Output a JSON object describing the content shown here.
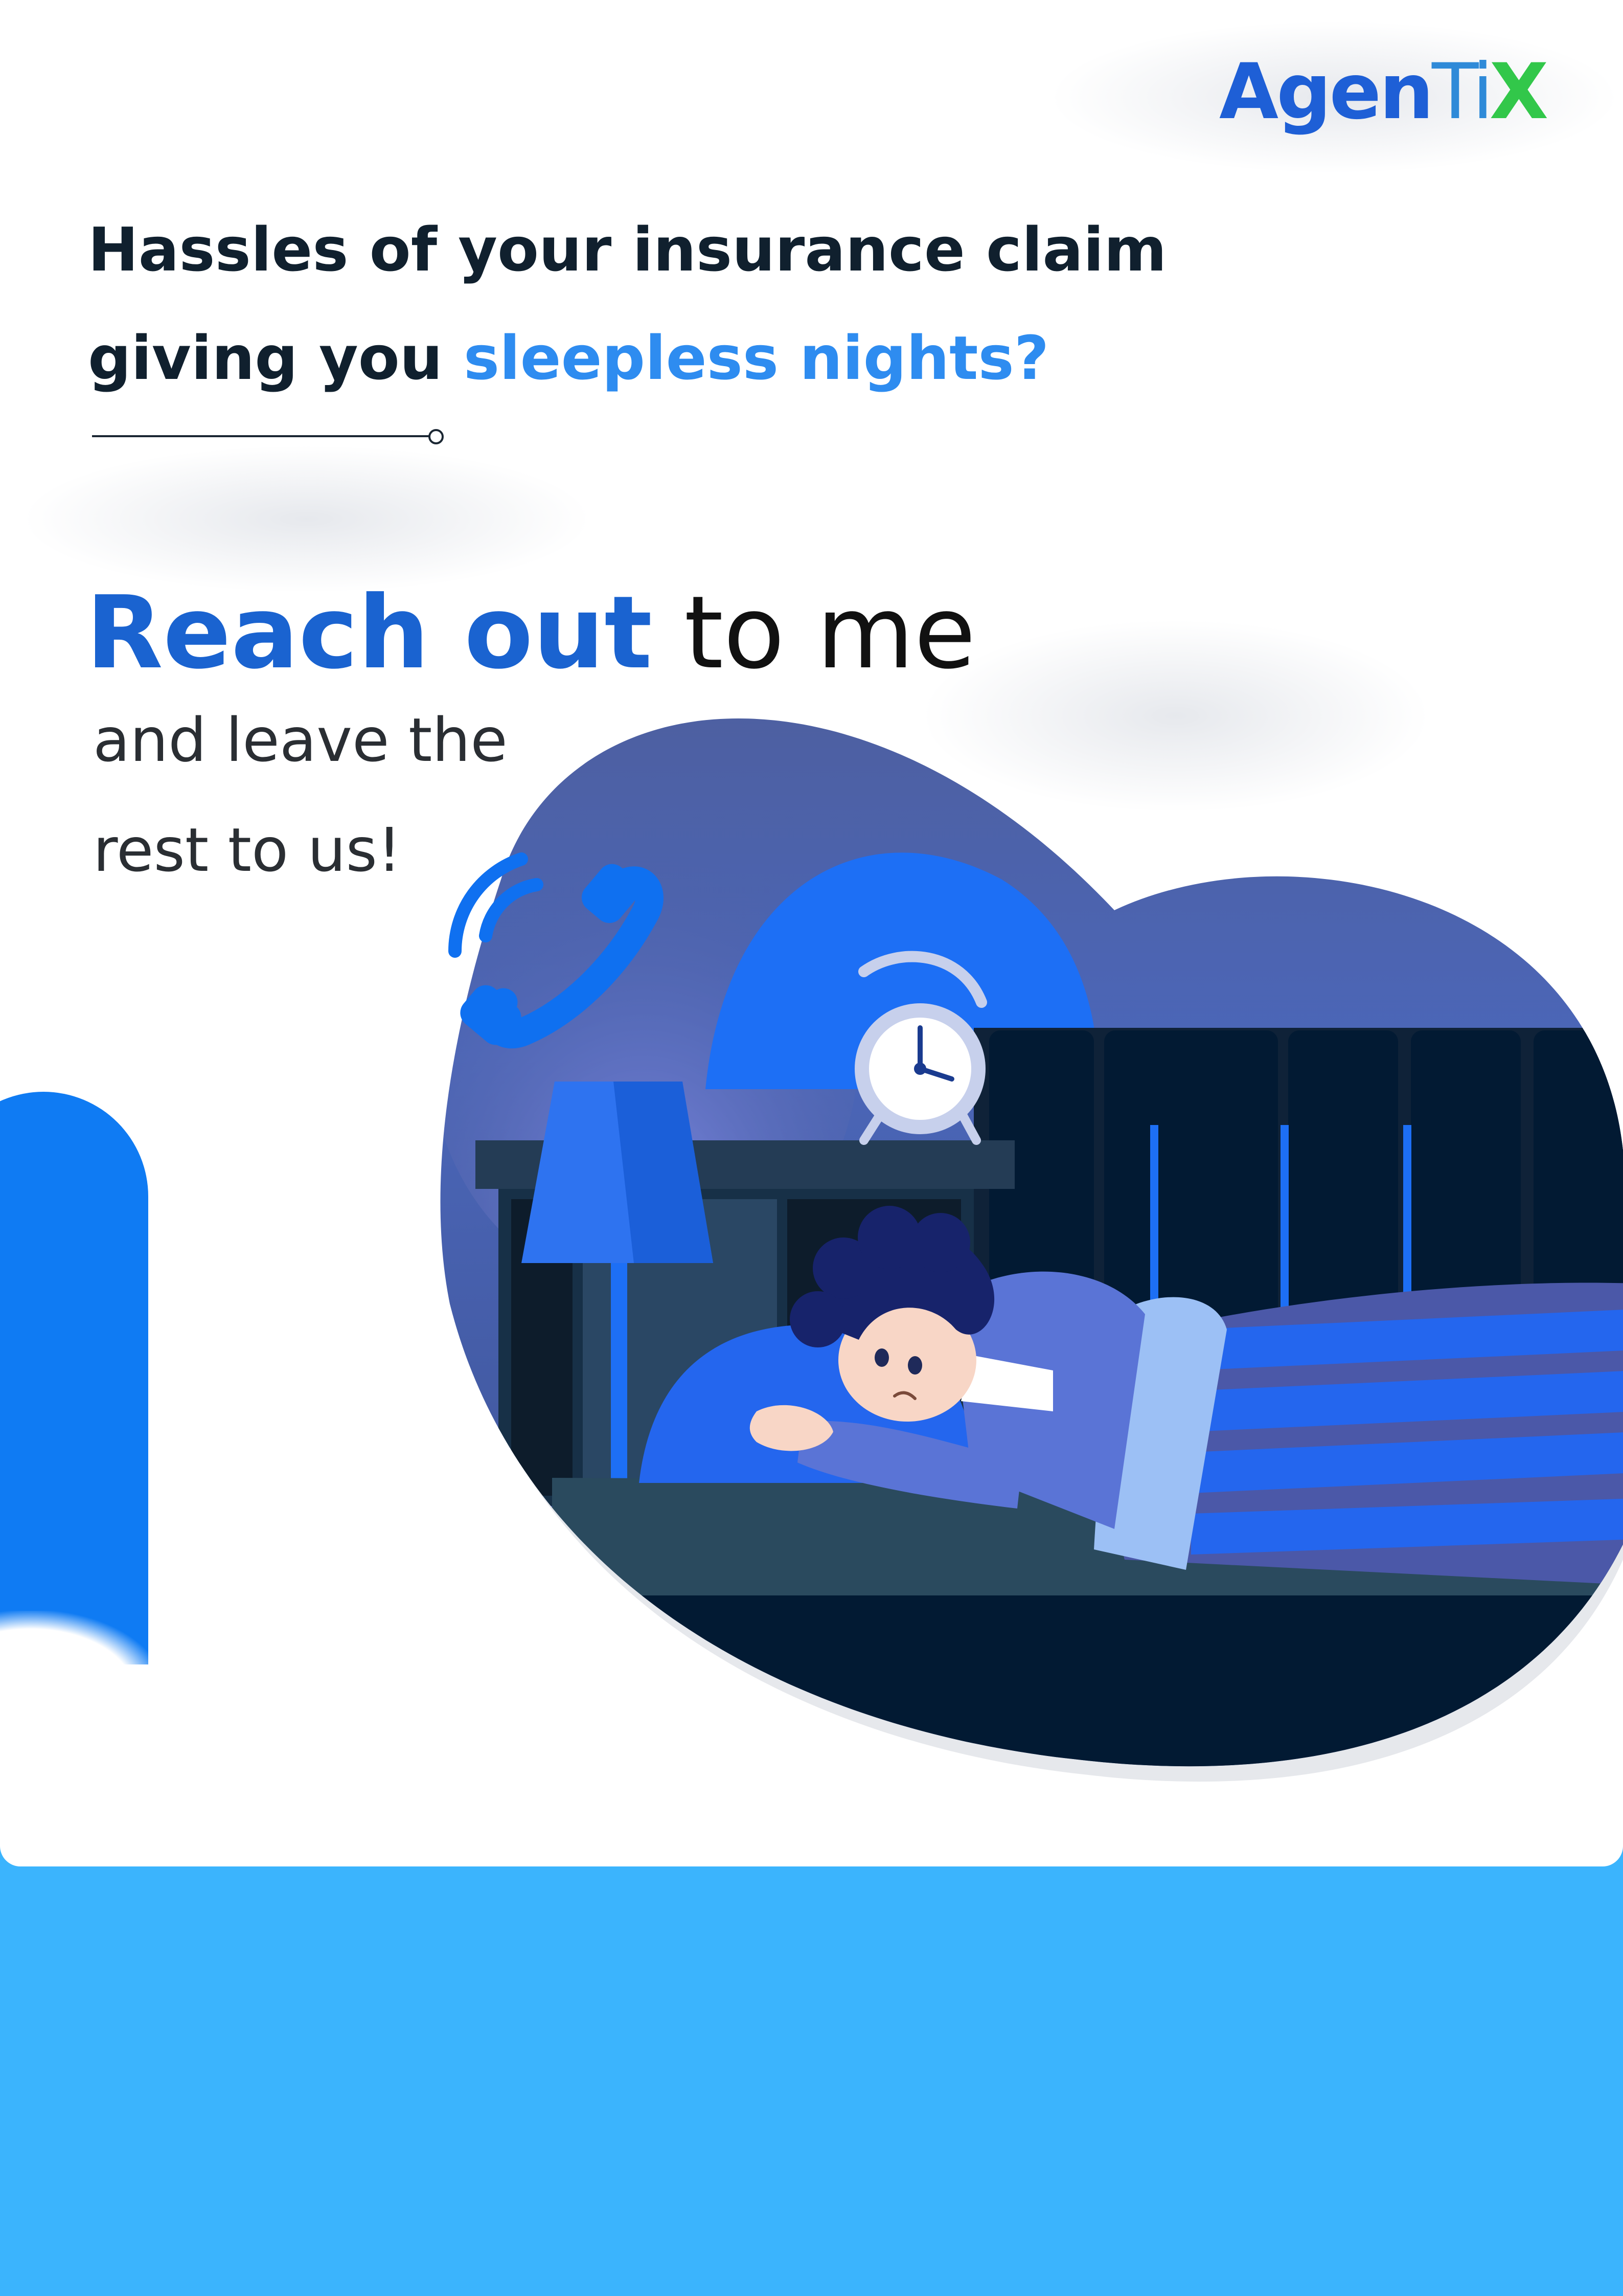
{
  "logo": {
    "part_a": "Agen",
    "part_b": "Ti",
    "part_c": "X"
  },
  "headline": {
    "line1": "Hassles of your insurance claim",
    "line2_plain": "giving you ",
    "line2_accent": "sleepless nights?"
  },
  "cta": {
    "strong": "Reach out",
    "rest": " to me",
    "line1": "and leave the",
    "line2": "rest to us!"
  },
  "colors": {
    "brand_blue": "#1a63d0",
    "accent_blue": "#2e8cf0",
    "logo_green": "#32c74a",
    "footer_band": "#3bb4fd"
  },
  "icons": [
    "phone-ringing-icon",
    "alarm-clock-icon",
    "lamp-icon"
  ]
}
